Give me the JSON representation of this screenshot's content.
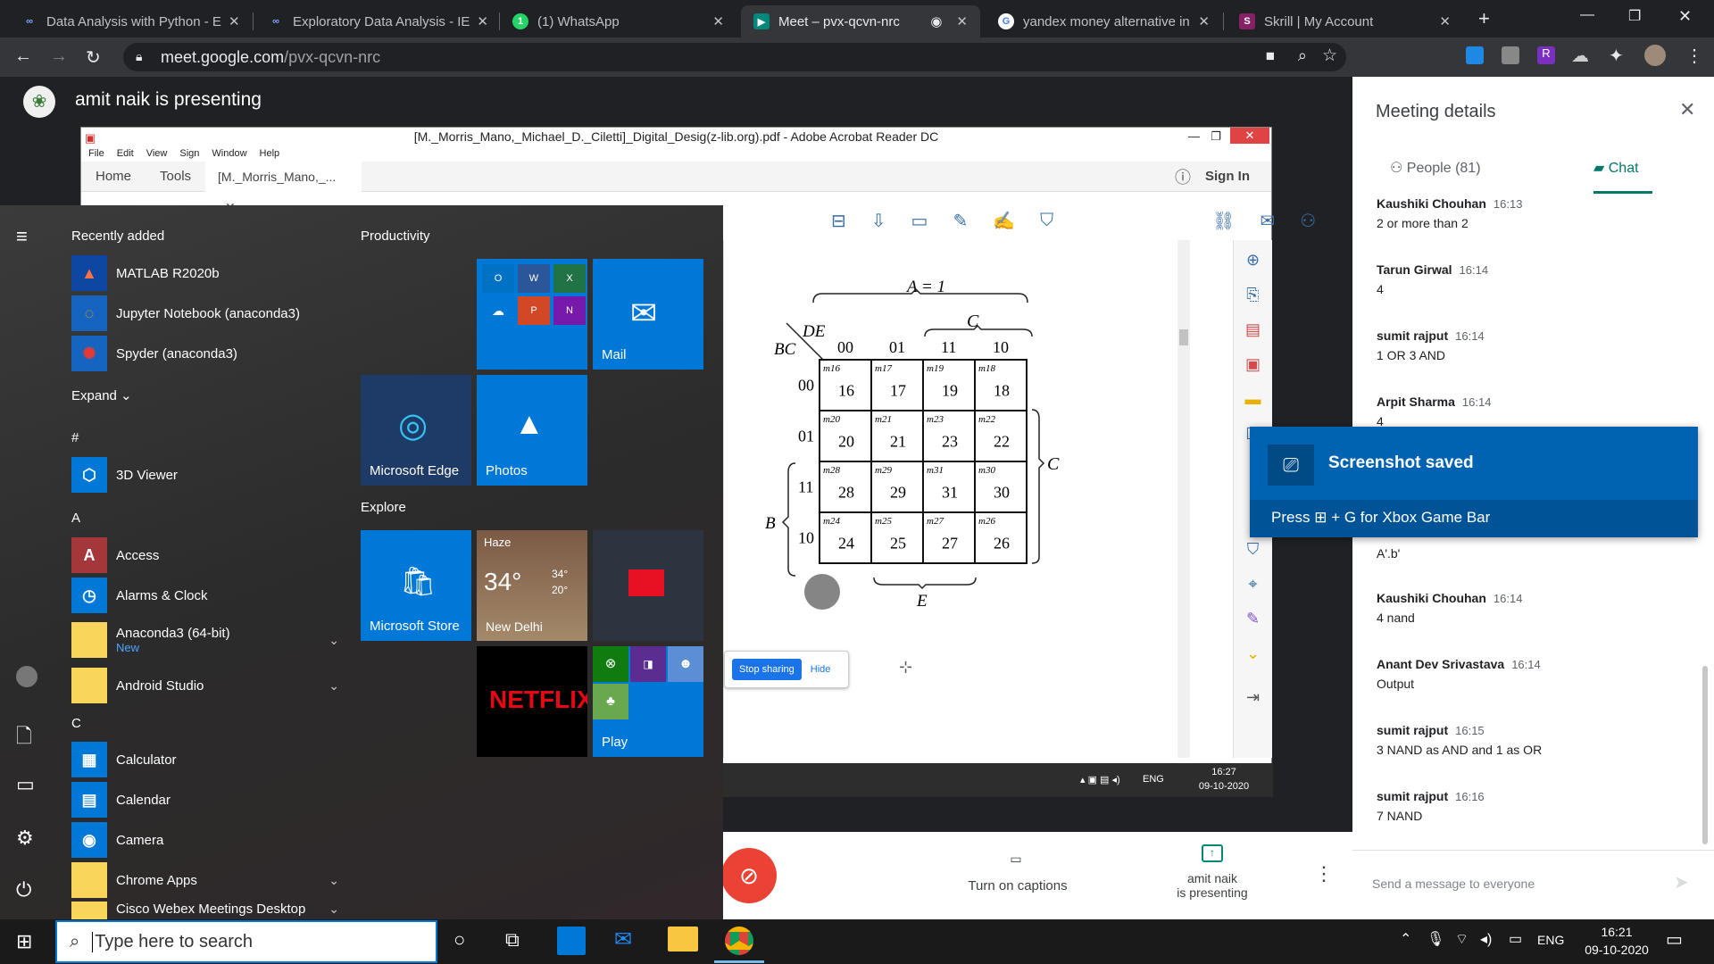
{
  "browser": {
    "tabs": [
      {
        "label": "Data Analysis with Python - E",
        "icon": "cognitive-class-icon"
      },
      {
        "label": "Exploratory Data Analysis - IE",
        "icon": "cognitive-class-icon"
      },
      {
        "label": "(1) WhatsApp",
        "icon": "whatsapp-icon"
      },
      {
        "label": "Meet – pvx-qcvn-nrc",
        "icon": "meet-icon"
      },
      {
        "label": "yandex money alternative in",
        "icon": "google-icon"
      },
      {
        "label": "Skrill | My Account",
        "icon": "skrill-icon"
      }
    ],
    "url_domain": "meet.google.com",
    "url_path": "/pvx-qcvn-nrc"
  },
  "meet": {
    "presenter_banner": "amit naik is presenting",
    "captions_label": "Turn on captions",
    "presenting_label_1": "amit naik",
    "presenting_label_2": "is presenting",
    "panel_title": "Meeting details",
    "people_tab": "People (81)",
    "chat_tab": "Chat",
    "message_placeholder": "Send a message to everyone",
    "messages": [
      {
        "name": "Kaushiki Chouhan",
        "time": "16:13",
        "text": "2 or more than 2"
      },
      {
        "name": "Tarun Girwal",
        "time": "16:14",
        "text": "4"
      },
      {
        "name": "sumit rajput",
        "time": "16:14",
        "text": "1 OR 3 AND"
      },
      {
        "name": "Arpit Sharma",
        "time": "16:14",
        "text": "4"
      },
      {
        "name": "",
        "time": "",
        "text": "A'.b'"
      },
      {
        "name": "Kaushiki Chouhan",
        "time": "16:14",
        "text": "4 nand"
      },
      {
        "name": "Anant Dev Srivastava",
        "time": "16:14",
        "text": "Output"
      },
      {
        "name": "sumit rajput",
        "time": "16:15",
        "text": "3 NAND as AND and 1 as OR"
      },
      {
        "name": "sumit rajput",
        "time": "16:16",
        "text": "7 NAND"
      }
    ]
  },
  "pdf": {
    "title": "[M._Morris_Mano,_Michael_D._Ciletti]_Digital_Desig(z-lib.org).pdf - Adobe Acrobat Reader DC",
    "menu": [
      "File",
      "Edit",
      "View",
      "Sign",
      "Window",
      "Help"
    ],
    "tabs": [
      "Home",
      "Tools",
      "[M._Morris_Mano,_..."
    ],
    "sign_in": "Sign In",
    "kmap": {
      "top_label": "A = 1",
      "de_label": "DE",
      "bc_label": "BC",
      "c_top": "C",
      "c_right": "C",
      "b_left": "B",
      "e_bottom": "E",
      "cols": [
        "00",
        "01",
        "11",
        "10"
      ],
      "rows": [
        "00",
        "01",
        "11",
        "10"
      ],
      "cells": [
        [
          {
            "m": "m16",
            "v": "16"
          },
          {
            "m": "m17",
            "v": "17"
          },
          {
            "m": "m19",
            "v": "19"
          },
          {
            "m": "m18",
            "v": "18"
          }
        ],
        [
          {
            "m": "m20",
            "v": "20"
          },
          {
            "m": "m21",
            "v": "21"
          },
          {
            "m": "m23",
            "v": "23"
          },
          {
            "m": "m22",
            "v": "22"
          }
        ],
        [
          {
            "m": "m28",
            "v": "28"
          },
          {
            "m": "m29",
            "v": "29"
          },
          {
            "m": "m31",
            "v": "31"
          },
          {
            "m": "m30",
            "v": "30"
          }
        ],
        [
          {
            "m": "m24",
            "v": "24"
          },
          {
            "m": "m25",
            "v": "25"
          },
          {
            "m": "m27",
            "v": "27"
          },
          {
            "m": "m26",
            "v": "26"
          }
        ]
      ]
    },
    "stop_sharing": "Stop sharing",
    "hide": "Hide",
    "inner_lang": "ENG",
    "inner_time": "16:27",
    "inner_date": "09-10-2020"
  },
  "startmenu": {
    "recently_added": "Recently added",
    "recent_apps": [
      "MATLAB R2020b",
      "Jupyter Notebook (anaconda3)",
      "Spyder (anaconda3)"
    ],
    "expand": "Expand",
    "hash": "#",
    "letter_a": "A",
    "letter_c": "C",
    "apps_hash": [
      "3D Viewer"
    ],
    "apps_a": [
      "Access",
      "Alarms & Clock",
      "Anaconda3 (64-bit)",
      "Android Studio"
    ],
    "anaconda_badge": "New",
    "apps_c": [
      "Calculator",
      "Calendar",
      "Camera",
      "Chrome Apps",
      "Cisco Webex Meetings Desktop"
    ],
    "productivity": "Productivity",
    "explore": "Explore",
    "tiles": {
      "mail": "Mail",
      "edge": "Microsoft Edge",
      "photos": "Photos",
      "store": "Microsoft Store",
      "weather_cond": "Haze",
      "weather_temp": "34°",
      "weather_hi": "34°",
      "weather_lo": "20°",
      "weather_city": "New Delhi",
      "netflix": "NETFLIX",
      "play": "Play"
    }
  },
  "toast": {
    "title": "Screenshot saved",
    "hint_pre": "Press",
    "hint_post": "+ G for Xbox Game Bar"
  },
  "taskbar": {
    "search_placeholder": "Type here to search",
    "lang": "ENG",
    "time": "16:21",
    "date": "09-10-2020"
  }
}
